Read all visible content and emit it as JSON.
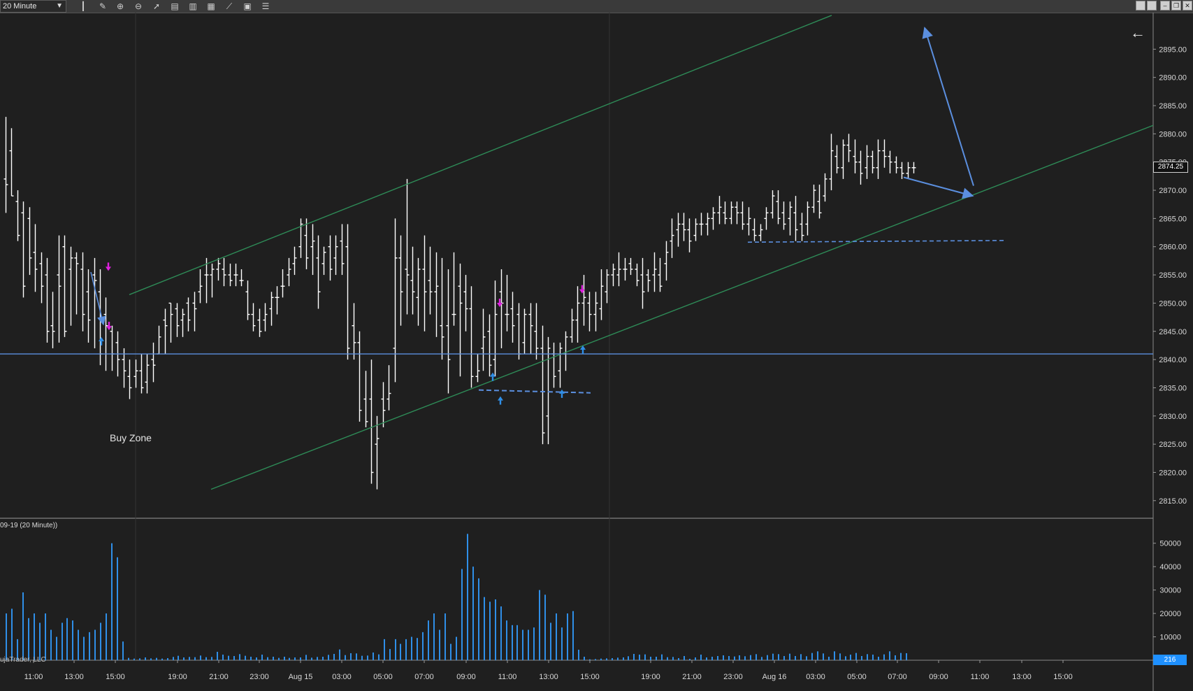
{
  "toolbar": {
    "interval": "20 Minute",
    "icons": [
      "bar-style-icon",
      "draw-pencil-icon",
      "zoom-in-icon",
      "zoom-out-icon",
      "pointer-icon",
      "data-box-icon",
      "properties-icon",
      "indicators-icon",
      "strategies-icon",
      "templates-icon",
      "list-icon"
    ]
  },
  "price_axis": {
    "labels": [
      "2895.00",
      "2890.00",
      "2885.00",
      "2880.00",
      "2875.00",
      "2870.00",
      "2865.00",
      "2860.00",
      "2855.00",
      "2850.00",
      "2845.00",
      "2840.00",
      "2835.00",
      "2830.00",
      "2825.00",
      "2820.00",
      "2815.00"
    ],
    "current_price": "2874.25",
    "range": [
      2812,
      2900
    ]
  },
  "volume_axis": {
    "labels": [
      "50000",
      "40000",
      "30000",
      "20000",
      "10000"
    ],
    "current_volume": "216",
    "range": [
      0,
      55000
    ]
  },
  "time_axis": {
    "labels": [
      "11:00",
      "13:00",
      "15:00",
      "19:00",
      "21:00",
      "23:00",
      "Aug 15",
      "03:00",
      "05:00",
      "07:00",
      "09:00",
      "11:00",
      "13:00",
      "15:00",
      "19:00",
      "21:00",
      "23:00",
      "Aug 16",
      "03:00",
      "05:00",
      "07:00",
      "09:00",
      "11:00",
      "13:00",
      "15:00"
    ]
  },
  "volume_panel": {
    "title": "09-19 (20 Minute))"
  },
  "footer": {
    "copyright": "ujaTrader, LLC"
  },
  "annotations": {
    "buy_zone": "Buy Zone",
    "back_arrow": "←"
  },
  "colors": {
    "background": "#1f1f1f",
    "bar": "#ffffff",
    "channel": "#2e8b57",
    "support": "#5b8fdf",
    "volume": "#2f8fe8",
    "sell_marker": "#e020e0",
    "buy_marker": "#2f8fe8"
  },
  "chart_data": {
    "type": "ohlc",
    "price_bars": [
      [
        2872,
        2883,
        2866,
        2871
      ],
      [
        2877,
        2881,
        2869,
        2869
      ],
      [
        2868,
        2870,
        2861,
        2862
      ],
      [
        2866,
        2868,
        2851,
        2853
      ],
      [
        2865,
        2867,
        2855,
        2858
      ],
      [
        2859,
        2864,
        2852,
        2856
      ],
      [
        2857,
        2859,
        2850,
        2853
      ],
      [
        2855,
        2858,
        2843,
        2845
      ],
      [
        2846,
        2852,
        2842,
        2845
      ],
      [
        2855,
        2862,
        2843,
        2853
      ],
      [
        2860,
        2862,
        2844,
        2845
      ],
      [
        2856,
        2860,
        2846,
        2858
      ],
      [
        2858,
        2859,
        2848,
        2857
      ],
      [
        2856,
        2859,
        2845,
        2848
      ],
      [
        2852,
        2856,
        2843,
        2847
      ],
      [
        2855,
        2858,
        2842,
        2854
      ],
      [
        2852,
        2856,
        2839,
        2841
      ],
      [
        2848,
        2851,
        2838,
        2846
      ],
      [
        2845,
        2846,
        2838,
        2841
      ],
      [
        2843,
        2845,
        2837,
        2840
      ],
      [
        2840,
        2842,
        2835,
        2838
      ],
      [
        2837,
        2840,
        2833,
        2835
      ],
      [
        2837,
        2840,
        2835,
        2838
      ],
      [
        2838,
        2841,
        2834,
        2835
      ],
      [
        2836,
        2841,
        2834,
        2839
      ],
      [
        2840,
        2843,
        2836,
        2839
      ],
      [
        2841,
        2846,
        2841,
        2844
      ],
      [
        2847,
        2849,
        2841,
        2846
      ],
      [
        2850,
        2850,
        2843,
        2848
      ],
      [
        2849,
        2850,
        2844,
        2846
      ],
      [
        2847,
        2849,
        2844,
        2848
      ],
      [
        2850,
        2851,
        2845,
        2847
      ],
      [
        2850,
        2852,
        2845,
        2849
      ],
      [
        2852,
        2856,
        2850,
        2853
      ],
      [
        2855,
        2858,
        2850,
        2855
      ],
      [
        2855,
        2857,
        2851,
        2856
      ],
      [
        2856,
        2858,
        2854,
        2857
      ],
      [
        2856,
        2858,
        2853,
        2855
      ],
      [
        2855,
        2857,
        2853,
        2854
      ],
      [
        2855,
        2857,
        2853,
        2855
      ],
      [
        2854,
        2856,
        2853,
        2854
      ],
      [
        2852,
        2854,
        2847,
        2848
      ],
      [
        2848,
        2850,
        2845,
        2846
      ],
      [
        2847,
        2849,
        2844,
        2845
      ],
      [
        2847,
        2850,
        2845,
        2848
      ],
      [
        2849,
        2852,
        2846,
        2851
      ],
      [
        2851,
        2853,
        2848,
        2851
      ],
      [
        2853,
        2856,
        2851,
        2853
      ],
      [
        2855,
        2858,
        2853,
        2856
      ],
      [
        2857,
        2860,
        2855,
        2858
      ],
      [
        2860,
        2865,
        2858,
        2864
      ],
      [
        2862,
        2865,
        2856,
        2858
      ],
      [
        2860,
        2864,
        2855,
        2861
      ],
      [
        2858,
        2862,
        2849,
        2852
      ],
      [
        2857,
        2860,
        2855,
        2859
      ],
      [
        2860,
        2862,
        2854,
        2856
      ],
      [
        2858,
        2862,
        2855,
        2860
      ],
      [
        2861,
        2864,
        2855,
        2857
      ],
      [
        2860,
        2864,
        2840,
        2842
      ],
      [
        2846,
        2850,
        2840,
        2843
      ],
      [
        2843,
        2845,
        2829,
        2831
      ],
      [
        2833,
        2838,
        2828,
        2829
      ],
      [
        2833,
        2840,
        2818,
        2820
      ],
      [
        2825,
        2830,
        2817,
        2826
      ],
      [
        2833,
        2836,
        2828,
        2831
      ],
      [
        2833,
        2839,
        2831,
        2834
      ],
      [
        2842,
        2865,
        2836,
        2858
      ],
      [
        2858,
        2862,
        2846,
        2852
      ],
      [
        2856,
        2872,
        2848,
        2855
      ],
      [
        2854,
        2860,
        2848,
        2852
      ],
      [
        2851,
        2858,
        2846,
        2856
      ],
      [
        2856,
        2862,
        2845,
        2852
      ],
      [
        2854,
        2860,
        2848,
        2852
      ],
      [
        2852,
        2859,
        2844,
        2853
      ],
      [
        2846,
        2858,
        2840,
        2844
      ],
      [
        2846,
        2856,
        2834,
        2840
      ],
      [
        2848,
        2859,
        2846,
        2848
      ],
      [
        2853,
        2857,
        2837,
        2850
      ],
      [
        2852,
        2855,
        2845,
        2849
      ],
      [
        2849,
        2853,
        2835,
        2837
      ],
      [
        2837,
        2841,
        2836,
        2838
      ],
      [
        2842,
        2849,
        2838,
        2844
      ],
      [
        2845,
        2848,
        2837,
        2839
      ],
      [
        2840,
        2854,
        2837,
        2848
      ],
      [
        2852,
        2856,
        2842,
        2850
      ],
      [
        2848,
        2855,
        2845,
        2848
      ],
      [
        2849,
        2852,
        2843,
        2846
      ],
      [
        2848,
        2850,
        2840,
        2841
      ],
      [
        2843,
        2849,
        2841,
        2848
      ],
      [
        2848,
        2850,
        2841,
        2846
      ],
      [
        2845,
        2850,
        2840,
        2842
      ],
      [
        2842,
        2846,
        2825,
        2827
      ],
      [
        2830,
        2844,
        2825,
        2842
      ],
      [
        2841,
        2843,
        2835,
        2837
      ],
      [
        2838,
        2843,
        2835,
        2842
      ],
      [
        2841,
        2845,
        2838,
        2844
      ],
      [
        2844,
        2849,
        2843,
        2847
      ],
      [
        2847,
        2853,
        2843,
        2850
      ],
      [
        2850,
        2855,
        2846,
        2851
      ],
      [
        2850,
        2852,
        2845,
        2848
      ],
      [
        2848,
        2852,
        2845,
        2850
      ],
      [
        2849,
        2856,
        2847,
        2853
      ],
      [
        2852,
        2856,
        2850,
        2855
      ],
      [
        2855,
        2857,
        2853,
        2856
      ],
      [
        2855,
        2859,
        2853,
        2856
      ],
      [
        2856,
        2858,
        2854,
        2856
      ],
      [
        2857,
        2858,
        2855,
        2856
      ],
      [
        2856,
        2857,
        2853,
        2854
      ],
      [
        2855,
        2858,
        2849,
        2852
      ],
      [
        2855,
        2856,
        2852,
        2854
      ],
      [
        2855,
        2859,
        2852,
        2856
      ],
      [
        2855,
        2858,
        2852,
        2853
      ],
      [
        2857,
        2861,
        2854,
        2859
      ],
      [
        2861,
        2865,
        2858,
        2862
      ],
      [
        2863,
        2866,
        2860,
        2864
      ],
      [
        2864,
        2866,
        2861,
        2863
      ],
      [
        2863,
        2865,
        2859,
        2861
      ],
      [
        2862,
        2865,
        2861,
        2864
      ],
      [
        2864,
        2866,
        2862,
        2864
      ],
      [
        2864,
        2866,
        2862,
        2865
      ],
      [
        2865,
        2867,
        2863,
        2866
      ],
      [
        2866,
        2869,
        2864,
        2867
      ],
      [
        2866,
        2868,
        2864,
        2865
      ],
      [
        2865,
        2868,
        2864,
        2867
      ],
      [
        2867,
        2868,
        2864,
        2866
      ],
      [
        2866,
        2868,
        2863,
        2864
      ],
      [
        2864,
        2867,
        2862,
        2865
      ],
      [
        2863,
        2865,
        2861,
        2862
      ],
      [
        2862,
        2864,
        2861,
        2863
      ],
      [
        2865,
        2867,
        2863,
        2866
      ],
      [
        2866,
        2870,
        2865,
        2869
      ],
      [
        2868,
        2870,
        2864,
        2865
      ],
      [
        2866,
        2868,
        2863,
        2864
      ],
      [
        2865,
        2868,
        2862,
        2867
      ],
      [
        2866,
        2869,
        2861,
        2863
      ],
      [
        2864,
        2866,
        2861,
        2862
      ],
      [
        2864,
        2868,
        2862,
        2867
      ],
      [
        2867,
        2871,
        2866,
        2870
      ],
      [
        2868,
        2871,
        2865,
        2866
      ],
      [
        2869,
        2873,
        2868,
        2872
      ],
      [
        2872,
        2880,
        2870,
        2877
      ],
      [
        2876,
        2878,
        2873,
        2874
      ],
      [
        2874,
        2879,
        2872,
        2878
      ],
      [
        2878,
        2880,
        2875,
        2877
      ],
      [
        2876,
        2879,
        2873,
        2875
      ],
      [
        2875,
        2877,
        2871,
        2873
      ],
      [
        2874,
        2878,
        2872,
        2876
      ],
      [
        2876,
        2877,
        2873,
        2874
      ],
      [
        2874,
        2879,
        2872,
        2877
      ],
      [
        2877,
        2879,
        2874,
        2876
      ],
      [
        2876,
        2877,
        2873,
        2875
      ],
      [
        2875,
        2876,
        2873,
        2874
      ],
      [
        2874,
        2875,
        2872,
        2873
      ],
      [
        2873,
        2875,
        2872,
        2874
      ],
      [
        2874,
        2875,
        2873,
        2874
      ]
    ],
    "volume": [
      20000,
      22000,
      9000,
      29000,
      18000,
      20000,
      16000,
      20000,
      13000,
      10000,
      16000,
      18000,
      17000,
      13000,
      10000,
      12000,
      13000,
      16000,
      20000,
      50000,
      44000,
      8000,
      1000,
      700,
      800,
      1200,
      800,
      1000,
      700,
      900,
      1400,
      1900,
      1200,
      1400,
      1300,
      2000,
      1300,
      1400,
      3600,
      2400,
      1900,
      1800,
      2600,
      1900,
      1500,
      1200,
      2400,
      1300,
      1500,
      1000,
      1500,
      1000,
      1200,
      1200,
      2300,
      1100,
      1400,
      1500,
      2300,
      2700,
      4600,
      2200,
      3000,
      2900,
      1900,
      2000,
      3300,
      2500,
      9000,
      4800,
      9000,
      7000,
      9000,
      10000,
      9500,
      12000,
      17000,
      20000,
      13000,
      20000,
      7000,
      10000,
      39000,
      54000,
      40000,
      35000,
      27000,
      25000,
      26000,
      23000,
      17000,
      15000,
      15000,
      13000,
      13000,
      14000,
      30000,
      28000,
      16000,
      20000,
      14000,
      20000,
      21000,
      4500,
      1500,
      400,
      500,
      700,
      800,
      900,
      1100,
      1200,
      1700,
      2700,
      2400,
      2500,
      1500,
      1500,
      2500,
      1300,
      1400,
      900,
      1800,
      600,
      1200,
      2400,
      1200,
      1500,
      1800,
      2100,
      1800,
      1600,
      2100,
      1700,
      2200,
      2600,
      1400,
      2200,
      2800,
      2600,
      1800,
      2800,
      1800,
      2600,
      1700,
      3100,
      3800,
      2900,
      1500,
      3800,
      2900,
      1700,
      2400,
      3100,
      1800,
      2600,
      2400,
      1500,
      2500,
      3800,
      2100,
      3100,
      3000
    ],
    "overlays": {
      "channel_upper": [
        [
          2851.5,
          2901.0
        ]
      ],
      "channel_lower": [
        [
          2817.0,
          2881.5
        ]
      ],
      "support_level": 2841,
      "support_dashed": [
        [
          2835,
          2834
        ],
        [
          2861,
          2861
        ]
      ]
    }
  }
}
